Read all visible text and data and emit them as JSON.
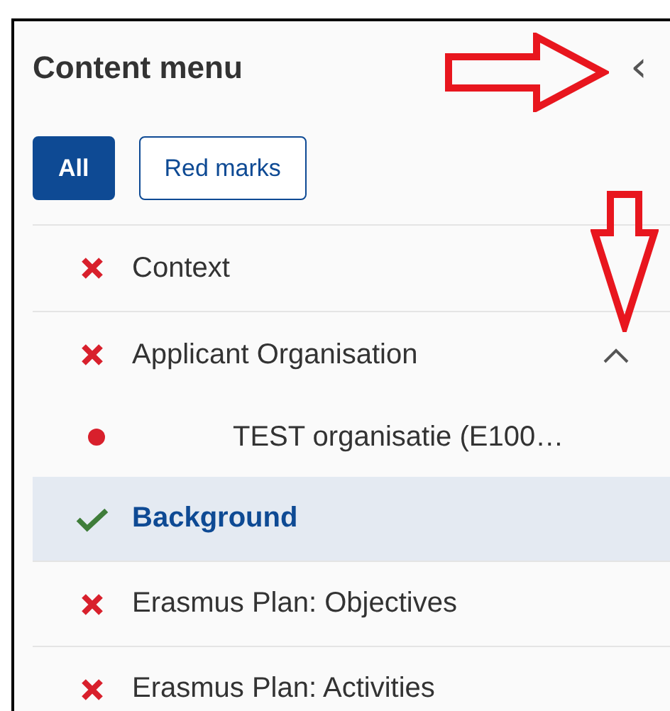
{
  "panel": {
    "title": "Content menu",
    "collapse_button": {
      "glyph": "‹"
    }
  },
  "filters": [
    {
      "label": "All",
      "selected": true
    },
    {
      "label": "Red marks",
      "selected": false
    }
  ],
  "items": [
    {
      "label": "Context",
      "kind": "error",
      "selected": false
    },
    {
      "label": "Applicant Organisation",
      "kind": "error",
      "selected": false,
      "expanded": true,
      "children": [
        {
          "label": "TEST organisatie (E100…",
          "kind": "dot",
          "selected": false
        }
      ]
    },
    {
      "label": "Background",
      "kind": "ok",
      "selected": true
    },
    {
      "label": "Erasmus Plan: Objectives",
      "kind": "error",
      "selected": false
    },
    {
      "label": "Erasmus Plan: Activities",
      "kind": "error",
      "selected": false
    }
  ]
}
